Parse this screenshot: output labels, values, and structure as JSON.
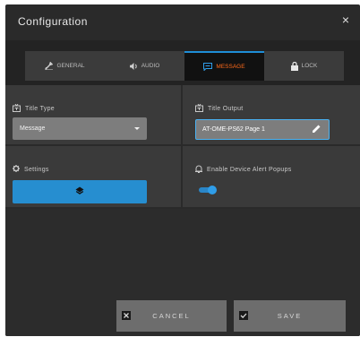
{
  "dialog": {
    "title": "Configuration",
    "close_label": "×"
  },
  "tabs": [
    {
      "label": "GENERAL",
      "icon": "wrench-icon",
      "active": false
    },
    {
      "label": "AUDIO",
      "icon": "speaker-icon",
      "active": false
    },
    {
      "label": "MESSAGE",
      "icon": "message-icon",
      "active": true
    },
    {
      "label": "LOCK",
      "icon": "lock-icon",
      "active": false
    }
  ],
  "title_type": {
    "label": "Title Type",
    "value": "Message"
  },
  "title_output": {
    "label": "Title Output",
    "value": "AT-OME-PS62 Page 1"
  },
  "settings": {
    "label": "Settings"
  },
  "alerts": {
    "label": "Enable Device Alert Popups",
    "enabled": true
  },
  "footer": {
    "cancel_label": "CANCEL",
    "save_label": "SAVE"
  },
  "colors": {
    "accent_blue": "#268ed0",
    "active_tab_text": "#ff6a1a",
    "panel_bg": "#3a3a3a",
    "dialog_bg": "#2a2a2a"
  }
}
